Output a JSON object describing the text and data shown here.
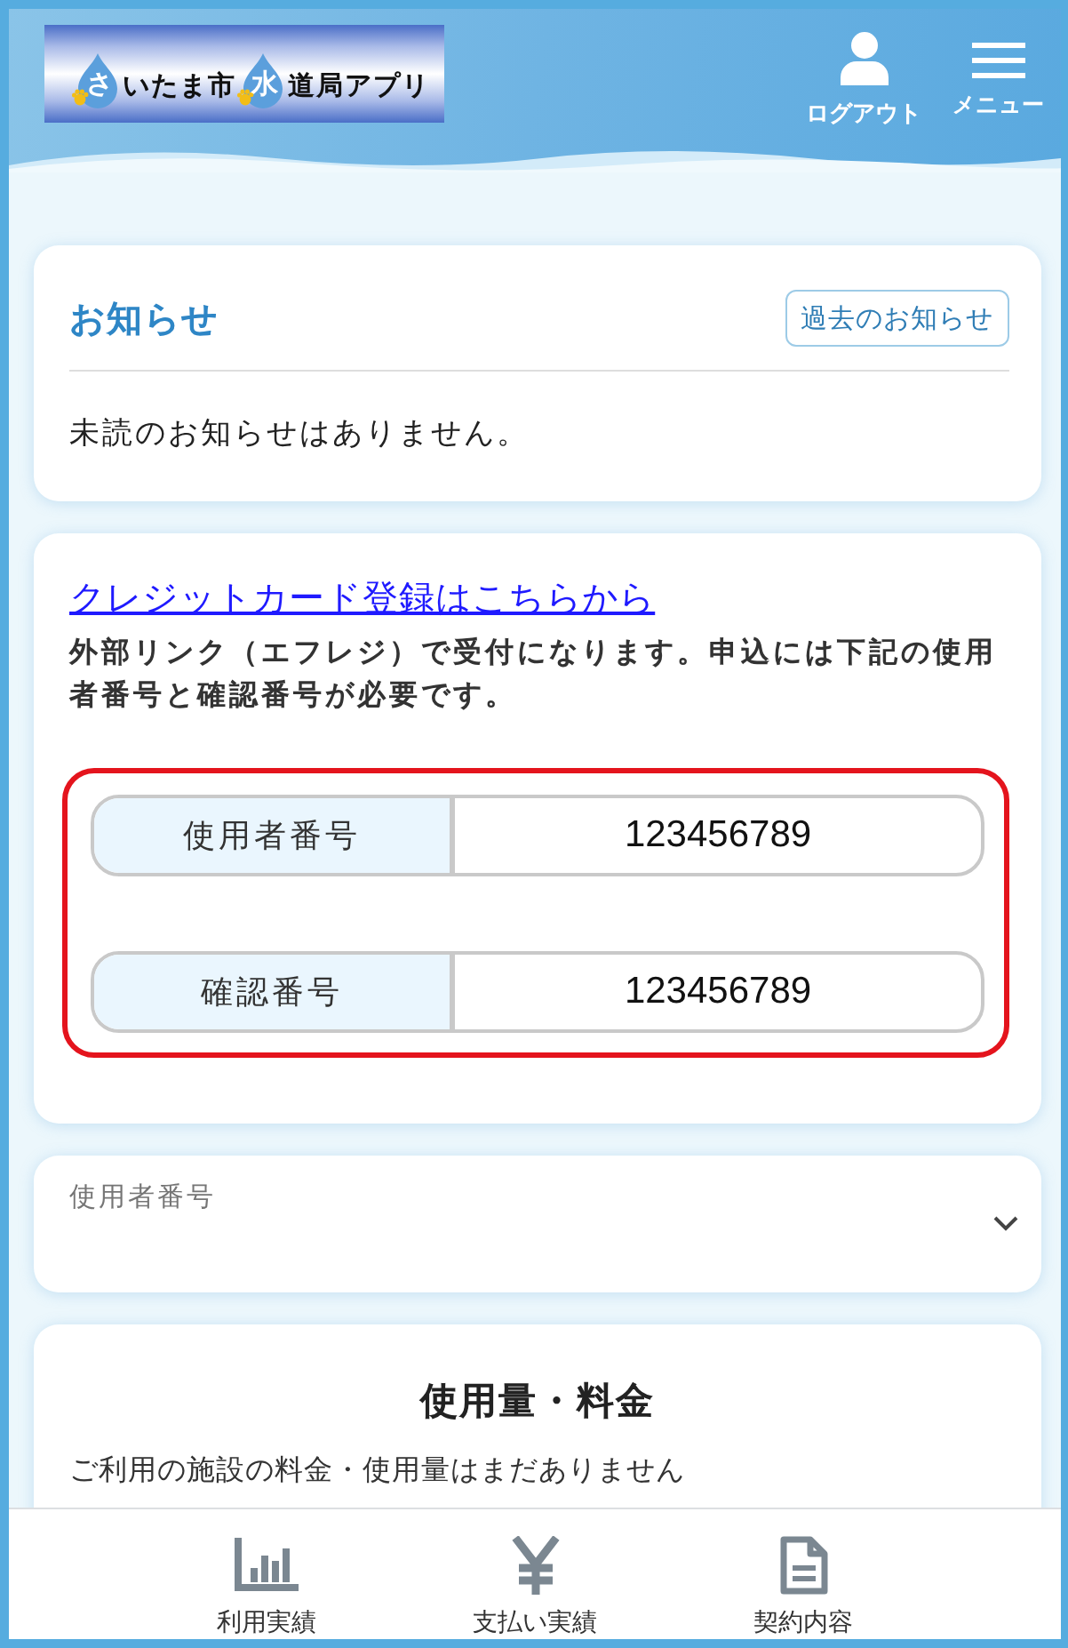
{
  "header": {
    "logo": [
      {
        "text": "さ",
        "kind": "drop"
      },
      {
        "text": "いたま市",
        "kind": "plain"
      },
      {
        "text": "水",
        "kind": "drop"
      },
      {
        "text": "道局アプリ",
        "kind": "plain"
      }
    ],
    "actions": [
      {
        "label": "ログアウト",
        "kind": "user"
      },
      {
        "label": "メニュー",
        "kind": "menu"
      }
    ]
  },
  "notices": {
    "title": "お知らせ",
    "history_button": "過去のお知らせ",
    "message": "未読のお知らせはありません。"
  },
  "credit_card": {
    "link": "クレジットカード登録はこちらから",
    "description": "外部リンク（エフレジ）で受付になります。申込には下記の使用者番号と確認番号が必要です。",
    "numbers": [
      {
        "label": "使用者番号",
        "value": "123456789"
      },
      {
        "label": "確認番号",
        "value": "123456789"
      }
    ]
  },
  "user_number_select": {
    "label": "使用者番号"
  },
  "usage": {
    "title": "使用量・料金",
    "message": "ご利用の施設の料金・使用量はまだありません"
  },
  "bottom_nav": [
    {
      "label": "利用実績",
      "kind": "chart"
    },
    {
      "label": "支払い実績",
      "kind": "yen"
    },
    {
      "label": "契約内容",
      "kind": "document"
    }
  ]
}
